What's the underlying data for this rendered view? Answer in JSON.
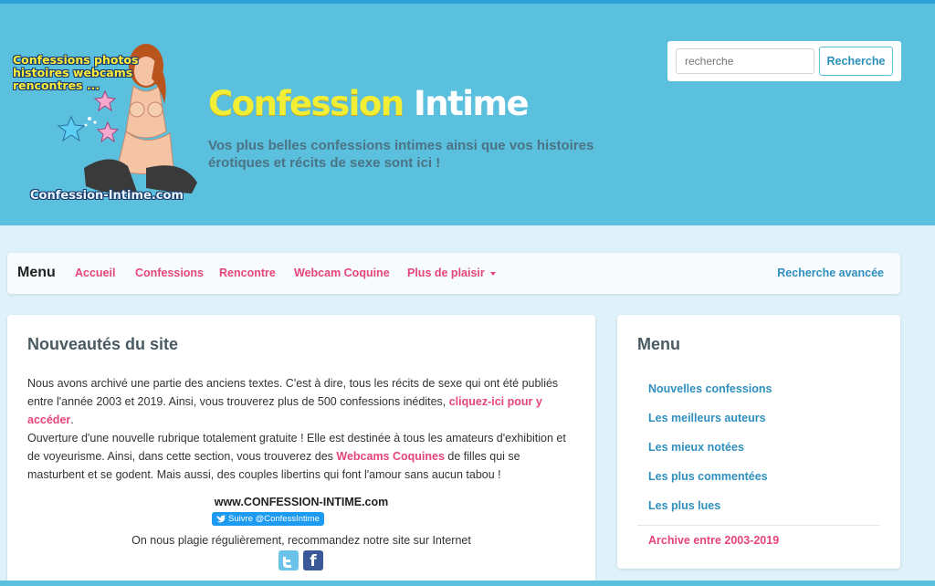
{
  "header": {
    "logo_caption": [
      "Confessions photos",
      "histoires webcams",
      "rencontres ..."
    ],
    "logo_domain": "Confession-Intime.com",
    "title_part1": "Confession",
    "title_part2": " Intime",
    "tagline": "Vos plus belles confessions intimes ainsi que vos histoires érotiques et récits de sexe sont ici !"
  },
  "search": {
    "placeholder": "recherche",
    "button_label": "Recherche"
  },
  "navbar": {
    "brand": "Menu",
    "items": [
      {
        "label": "Accueil"
      },
      {
        "label": "Confessions"
      },
      {
        "label": "Rencontre"
      },
      {
        "label": "Webcam Coquine"
      },
      {
        "label": "Plus de plaisir"
      }
    ],
    "advanced_search": "Recherche avancée"
  },
  "main": {
    "title": "Nouveautés du site",
    "para1_text": "Nous avons archivé une partie des anciens textes. C'est à dire, tous les récits de sexe qui ont été publiés entre l'année 2003 et 2019. Ainsi, vous trouverez plus de 500 confessions inédites, ",
    "para1_link": "cliquez-ici pour y accéder",
    "para1_end": ".",
    "para2_text": "Ouverture d'une nouvelle rubrique totalement gratuite ! Elle est destinée à tous les amateurs d'exhibition et de voyeurisme. Ainsi, dans cette section, vous trouverez des ",
    "para2_link": "Webcams Coquines",
    "para2_end": " de filles qui se masturbent et se godent. Mais aussi, des couples libertins qui font l'amour sans aucun tabou !",
    "site_url": "www.CONFESSION-INTIME.com",
    "twitter_follow": "Suivre @ConfessIntime",
    "recommend_note": "On nous plagie régulièrement, recommandez notre site sur Internet"
  },
  "sidebar": {
    "title": "Menu",
    "items": [
      {
        "label": "Nouvelles confessions"
      },
      {
        "label": "Les meilleurs auteurs"
      },
      {
        "label": "Les mieux notées"
      },
      {
        "label": "Les plus commentées"
      },
      {
        "label": "Les plus lues"
      }
    ],
    "archive": "Archive entre 2003-2019"
  },
  "colors": {
    "header_bg": "#5bc0de",
    "page_bg": "#dff2fb",
    "accent_pink": "#e6457a",
    "accent_blue": "#2e8fbf",
    "title_yellow": "#f2ee35"
  },
  "icons": {
    "twitter": "twitter-icon",
    "facebook": "facebook-icon",
    "caret": "caret-down-icon"
  }
}
